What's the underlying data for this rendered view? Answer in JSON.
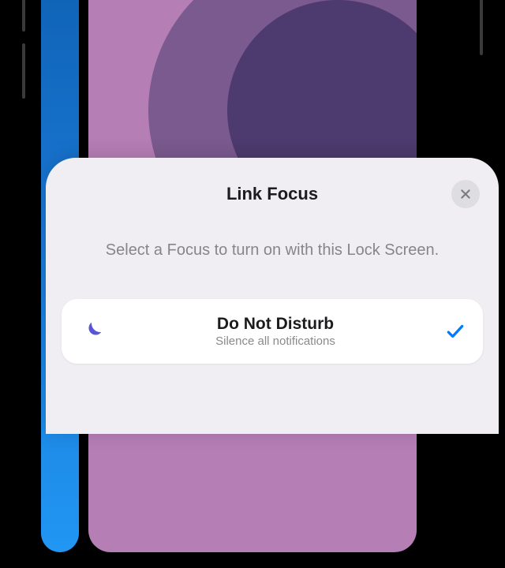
{
  "sheet": {
    "title": "Link Focus",
    "subtitle": "Select a Focus to turn on with this Lock Screen."
  },
  "focus_options": [
    {
      "name": "Do Not Disturb",
      "description": "Silence all notifications",
      "icon": "moon-icon",
      "selected": true
    }
  ],
  "colors": {
    "accent": "#5856d6",
    "check": "#007aff",
    "sheet_bg": "#f0eef2",
    "card_bg": "#ffffff"
  }
}
